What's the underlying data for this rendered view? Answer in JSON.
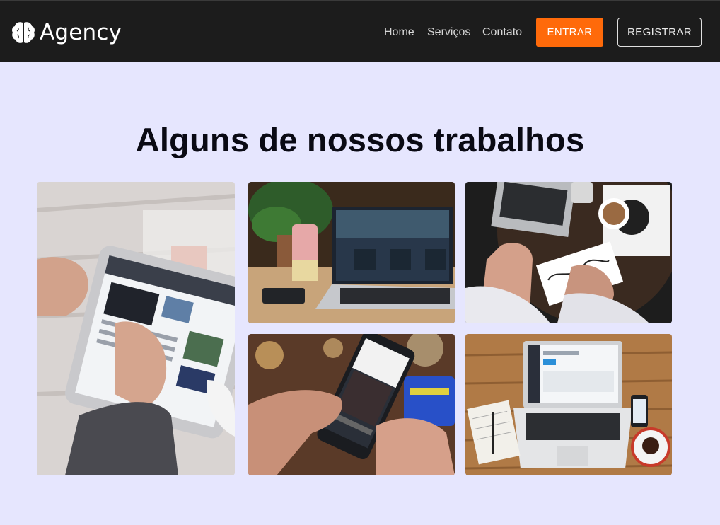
{
  "navbar": {
    "brand": "Agency",
    "brand_icon": "brain-icon",
    "links": [
      "Home",
      "Serviços",
      "Contato"
    ],
    "login_label": "ENTRAR",
    "register_label": "REGISTRAR"
  },
  "portfolio": {
    "title": "Alguns de nossos trabalhos",
    "images": [
      {
        "subject": "tablet-browsing"
      },
      {
        "subject": "laptop-pexels-on-desk"
      },
      {
        "subject": "laptop-coffee-sketch"
      },
      {
        "subject": "phone-shopping-card"
      },
      {
        "subject": "laptop-dashboard-wood-desk"
      }
    ]
  },
  "colors": {
    "navbar_bg": "#1c1c1c",
    "page_bg": "#e6e6fe",
    "accent": "#ff6a0a"
  }
}
